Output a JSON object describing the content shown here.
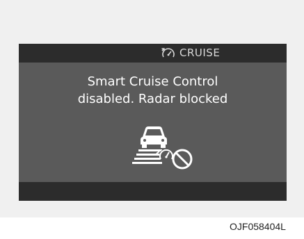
{
  "display": {
    "mode_label": "CRUISE",
    "mode_icon": "cruise-speedometer-icon",
    "message_line1": "Smart Cruise Control",
    "message_line2": "disabled. Radar blocked",
    "status_icon": "radar-blocked-icon"
  },
  "figure_code": "OJF058404L",
  "colors": {
    "screen": "#5a5a5a",
    "bar": "#2c2c2c",
    "text": "#ffffff"
  }
}
